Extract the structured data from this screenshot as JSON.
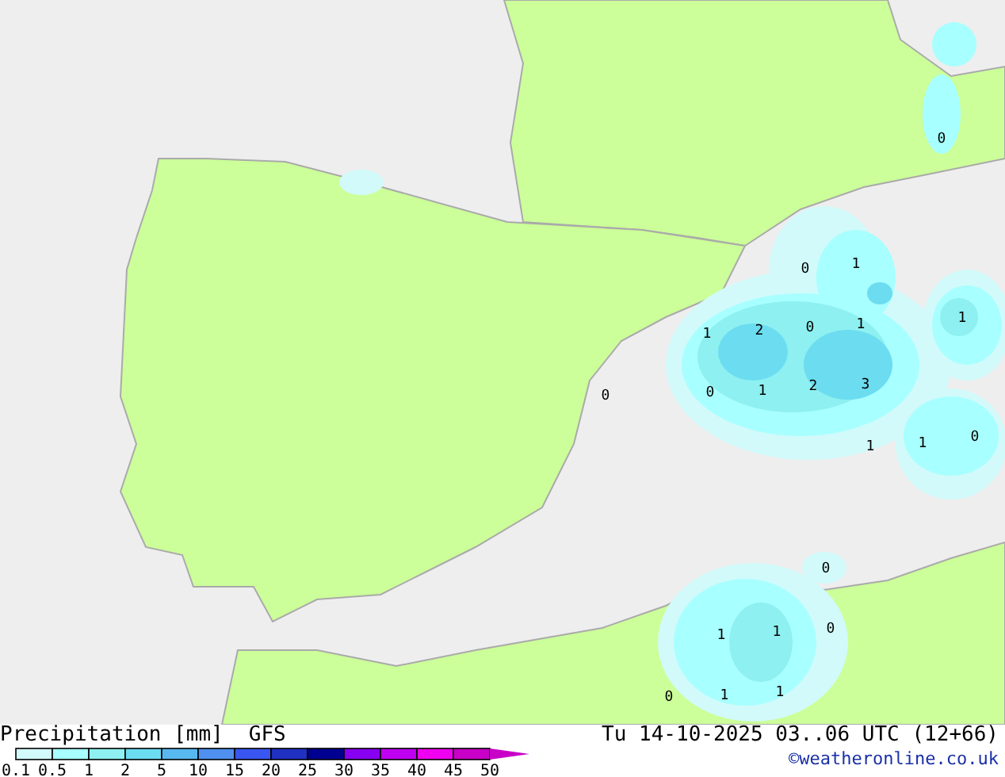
{
  "map": {
    "values": [
      "0",
      "0",
      "1",
      "1",
      "2",
      "0",
      "1",
      "1",
      "0",
      "0",
      "1",
      "2",
      "3",
      "1",
      "1",
      "0",
      "0",
      "1",
      "1",
      "0",
      "0",
      "1",
      "1"
    ]
  },
  "footer": {
    "title": "Precipitation [mm]",
    "model": "GFS",
    "date": "Tu 14-10-2025 03..06 UTC (12+66)",
    "credit": "©weatheronline.co.uk"
  },
  "legend": {
    "swatches": [
      {
        "color": "#d2fafa"
      },
      {
        "color": "#a8ffff"
      },
      {
        "color": "#8ef0f0"
      },
      {
        "color": "#6cdcf0"
      },
      {
        "color": "#58b8f0"
      },
      {
        "color": "#5090f0"
      },
      {
        "color": "#3a56f0"
      },
      {
        "color": "#2030c0"
      },
      {
        "color": "#000090"
      },
      {
        "color": "#8800f0"
      },
      {
        "color": "#c000f0"
      },
      {
        "color": "#f000f0"
      },
      {
        "color": "#c800c8"
      }
    ],
    "ticks": [
      "0.1",
      "0.5",
      "1",
      "2",
      "5",
      "10",
      "15",
      "20",
      "25",
      "30",
      "35",
      "40",
      "45",
      "50"
    ]
  }
}
